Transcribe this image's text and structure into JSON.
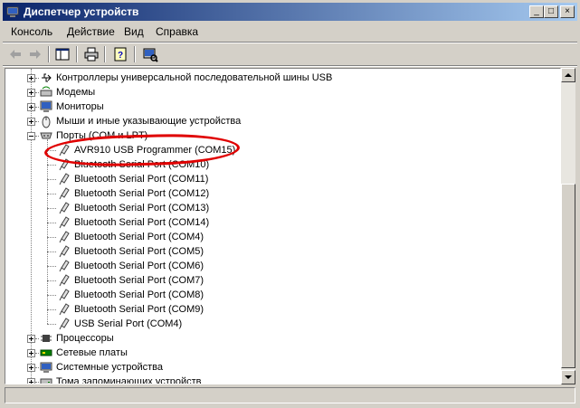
{
  "window": {
    "title": "Диспетчер устройств",
    "minimize": "_",
    "maximize": "□",
    "close": "×"
  },
  "menu": {
    "items": [
      "Консоль",
      "Действие",
      "Вид",
      "Справка"
    ]
  },
  "tree": {
    "categories_top": [
      {
        "label": "Контроллеры универсальной последовательной шины USB",
        "icon": "usb-icon"
      },
      {
        "label": "Модемы",
        "icon": "modem-icon"
      },
      {
        "label": "Мониторы",
        "icon": "monitor-icon"
      },
      {
        "label": "Мыши и иные указывающие устройства",
        "icon": "mouse-icon"
      }
    ],
    "ports": {
      "label": "Порты (COM и LPT)",
      "children": [
        "AVR910 USB Programmer (COM15)",
        "Bluetooth Serial Port (COM10)",
        "Bluetooth Serial Port (COM11)",
        "Bluetooth Serial Port (COM12)",
        "Bluetooth Serial Port (COM13)",
        "Bluetooth Serial Port (COM14)",
        "Bluetooth Serial Port (COM4)",
        "Bluetooth Serial Port (COM5)",
        "Bluetooth Serial Port (COM6)",
        "Bluetooth Serial Port (COM7)",
        "Bluetooth Serial Port (COM8)",
        "Bluetooth Serial Port (COM9)",
        "USB Serial Port (COM4)"
      ]
    },
    "categories_bottom": [
      {
        "label": "Процессоры",
        "icon": "processor-icon"
      },
      {
        "label": "Сетевые платы",
        "icon": "network-card-icon"
      },
      {
        "label": "Системные устройства",
        "icon": "system-devices-icon"
      },
      {
        "label": "Тома запоминающих устройств",
        "icon": "storage-volume-icon"
      }
    ]
  },
  "colors": {
    "titlebar_start": "#0a246a",
    "titlebar_end": "#a6caf0",
    "annotation": "#e00000"
  }
}
